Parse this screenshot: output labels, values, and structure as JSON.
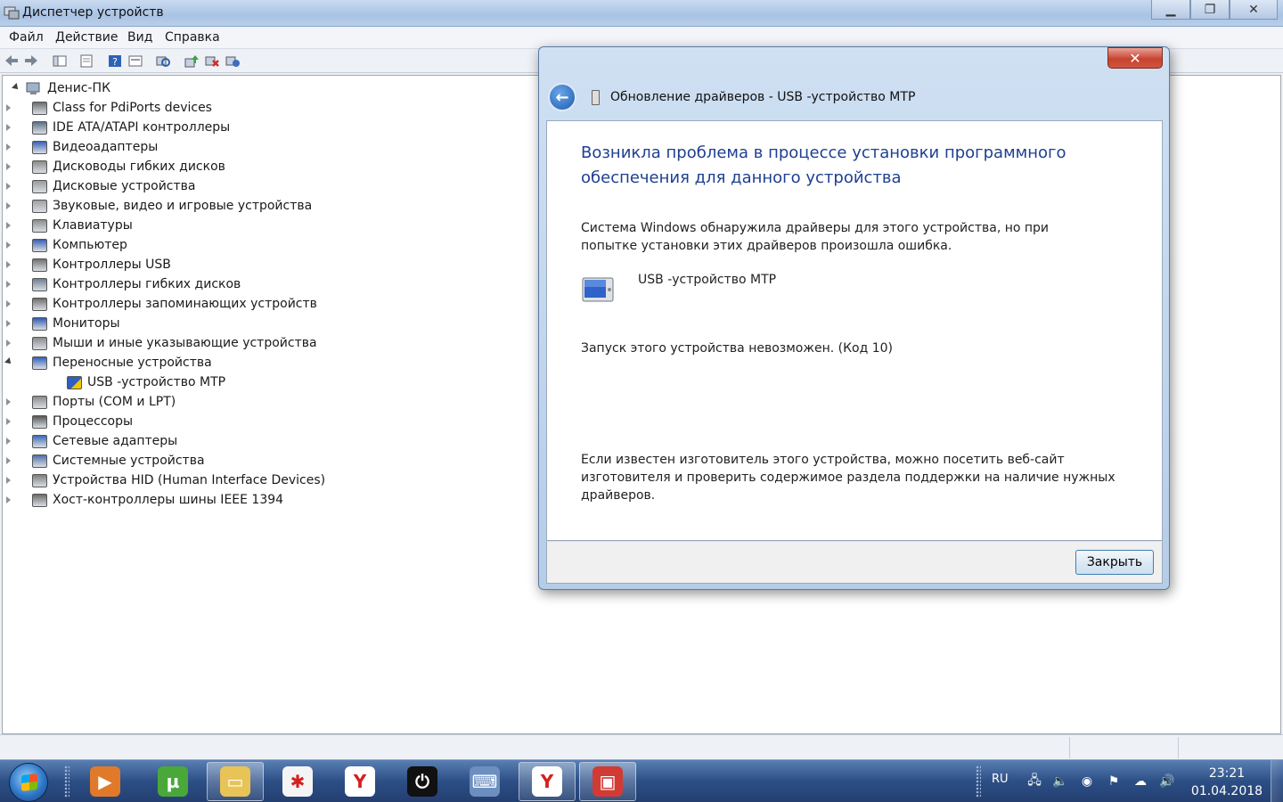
{
  "window": {
    "title": "Диспетчер устройств",
    "controls": {
      "minimize": "▁",
      "maximize": "❐",
      "close": "✕"
    }
  },
  "menu": [
    "Файл",
    "Действие",
    "Вид",
    "Справка"
  ],
  "toolbar": {
    "icons": [
      "back-icon",
      "forward-icon",
      "console-tree-icon",
      "properties-icon",
      "help-icon",
      "view-icon",
      "scan-hardware-icon",
      "update-driver-icon",
      "uninstall-icon",
      "disable-icon"
    ]
  },
  "tree": {
    "root": "Денис-ПК",
    "categories": [
      {
        "label": "Class for PdiPorts devices",
        "color": "#6d6d6d"
      },
      {
        "label": "IDE ATA/ATAPI контроллеры",
        "color": "#5a6f86"
      },
      {
        "label": "Видеоадаптеры",
        "color": "#3a62b6"
      },
      {
        "label": "Дисководы гибких дисков",
        "color": "#8a8a8a"
      },
      {
        "label": "Дисковые устройства",
        "color": "#9a9a9a"
      },
      {
        "label": "Звуковые, видео и игровые устройства",
        "color": "#a0a0a0"
      },
      {
        "label": "Клавиатуры",
        "color": "#8c8c8c"
      },
      {
        "label": "Компьютер",
        "color": "#3760b2"
      },
      {
        "label": "Контроллеры USB",
        "color": "#707070"
      },
      {
        "label": "Контроллеры гибких дисков",
        "color": "#6f7f92"
      },
      {
        "label": "Контроллеры запоминающих устройств",
        "color": "#6d6d6d"
      },
      {
        "label": "Мониторы",
        "color": "#2f58b0"
      },
      {
        "label": "Мыши и иные указывающие устройства",
        "color": "#8a8a8a"
      },
      {
        "label": "Переносные устройства",
        "color": "#2f5fbf"
      },
      {
        "label": "USB -устройство MTP",
        "color": "#2f5fbf"
      },
      {
        "label": "Порты (COM и LPT)",
        "color": "#8a8a8a"
      },
      {
        "label": "Процессоры",
        "color": "#555555"
      },
      {
        "label": "Сетевые адаптеры",
        "color": "#3c6ab7"
      },
      {
        "label": "Системные устройства",
        "color": "#4f6fa8"
      },
      {
        "label": "Устройства HID (Human Interface Devices)",
        "color": "#7d7d7d"
      },
      {
        "label": "Хост-контроллеры шины IEEE 1394",
        "color": "#6a6a6a"
      }
    ]
  },
  "dialog": {
    "title": "Обновление драйверов - USB -устройство MTP",
    "close_glyph": "✕",
    "back_glyph": "←",
    "heading": "Возникла проблема в процессе установки программного обеспечения для данного устройства",
    "message": "Система Windows обнаружила драйверы для этого устройства, но при попытке установки этих драйверов произошла ошибка.",
    "device_name": "USB -устройство MTP",
    "error": "Запуск этого устройства невозможен. (Код 10)",
    "advice": "Если известен изготовитель этого устройства, можно посетить веб-сайт изготовителя и проверить содержимое раздела поддержки на наличие нужных драйверов.",
    "close_button": "Закрыть"
  },
  "taskbar": {
    "apps": [
      {
        "name": "media-player-icon",
        "glyph": "▶",
        "bg": "#e07a2a"
      },
      {
        "name": "utorrent-icon",
        "glyph": "µ",
        "bg": "#4aa83a"
      },
      {
        "name": "explorer-folder-icon",
        "glyph": "▭",
        "bg": "#e8c356"
      },
      {
        "name": "pinwheel-app-icon",
        "glyph": "✱",
        "bg": "#f4f4f4"
      },
      {
        "name": "yandex-browser-icon",
        "glyph": "Y",
        "bg": "#ffffff"
      },
      {
        "name": "power-app-icon",
        "glyph": "⏻",
        "bg": "#111111"
      },
      {
        "name": "on-screen-keyboard-icon",
        "glyph": "⌨",
        "bg": "#6c8fc0"
      },
      {
        "name": "yandex-browser-icon-2",
        "glyph": "Y",
        "bg": "#ffffff"
      },
      {
        "name": "device-manager-toolbox-icon",
        "glyph": "▣",
        "bg": "#d23b33"
      }
    ],
    "language": "RU",
    "tray_icons": [
      {
        "name": "network-icon",
        "glyph": "🖧"
      },
      {
        "name": "volume-mute-icon",
        "glyph": "🔈"
      },
      {
        "name": "security-icon",
        "glyph": "◉"
      },
      {
        "name": "action-center-flag-icon",
        "glyph": "⚑"
      },
      {
        "name": "cloud-upload-icon",
        "glyph": "☁"
      },
      {
        "name": "speaker-icon",
        "glyph": "🔊"
      }
    ],
    "time": "23:21",
    "date": "01.04.2018"
  }
}
